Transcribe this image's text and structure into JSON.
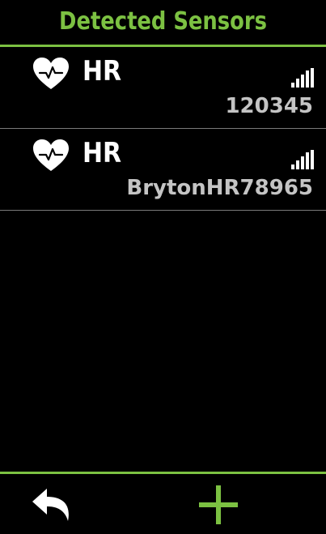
{
  "header": {
    "title": "Detected Sensors"
  },
  "sensors": [
    {
      "type": "HR",
      "id": "120345",
      "icon": "heart-rate-icon"
    },
    {
      "type": "HR",
      "id": "BrytonHR78965",
      "icon": "heart-rate-icon"
    }
  ],
  "footer": {
    "back_icon": "back-arrow-icon",
    "add_icon": "plus-icon"
  },
  "colors": {
    "accent": "#7cc142",
    "background": "#000000",
    "primary_text": "#ffffff",
    "secondary_text": "#c4c4c4",
    "divider": "#7a7a7a"
  }
}
